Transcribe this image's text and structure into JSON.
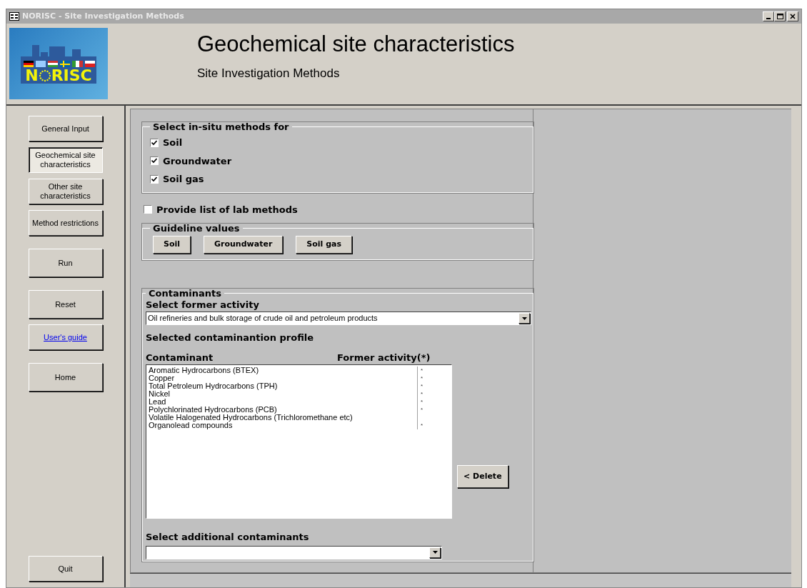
{
  "window": {
    "title": "NORISC - Site Investigation Methods"
  },
  "header": {
    "logo_letters": [
      "N",
      "RISC"
    ],
    "title": "Geochemical site characteristics",
    "subtitle": "Site Investigation Methods"
  },
  "sidebar": {
    "items": [
      {
        "label": "General Input",
        "kind": "nav",
        "selected": false
      },
      {
        "label": "Geochemical site characteristics",
        "kind": "nav",
        "selected": true
      },
      {
        "label": "Other site characteristics",
        "kind": "nav",
        "selected": false
      },
      {
        "label": "Method restrictions",
        "kind": "nav",
        "selected": false
      },
      {
        "label": "Run",
        "kind": "action",
        "selected": false
      },
      {
        "label": "Reset",
        "kind": "action",
        "selected": false
      },
      {
        "label": "User's guide",
        "kind": "link",
        "selected": false
      },
      {
        "label": "Home",
        "kind": "action",
        "selected": false
      }
    ],
    "quit": "Quit"
  },
  "in_situ": {
    "legend": "Select in-situ methods for",
    "options": [
      {
        "label": "Soil",
        "checked": true
      },
      {
        "label": "Groundwater",
        "checked": true
      },
      {
        "label": "Soil gas",
        "checked": true
      }
    ]
  },
  "lab_methods": {
    "label": "Provide list of lab methods",
    "checked": false
  },
  "guideline": {
    "legend": "Guideline values",
    "buttons": [
      "Soil",
      "Groundwater",
      "Soil gas"
    ]
  },
  "contaminants": {
    "legend": "Contaminants",
    "activity_label": "Select former activity",
    "activity_value": "Oil refineries and bulk storage of crude oil and petroleum products",
    "profile_label": "Selected contaminantion profile",
    "columns": [
      "Contaminant",
      "Former activity(*)"
    ],
    "rows": [
      {
        "name": "Aromatic Hydrocarbons (BTEX)",
        "former_activity": "*"
      },
      {
        "name": "Copper",
        "former_activity": "*"
      },
      {
        "name": "Total Petroleum Hydrocarbons (TPH)",
        "former_activity": "*"
      },
      {
        "name": "Nickel",
        "former_activity": "*"
      },
      {
        "name": "Lead",
        "former_activity": "*"
      },
      {
        "name": "Polychlorinated Hydrocarbons (PCB)",
        "former_activity": "*"
      },
      {
        "name": "Volatile Halogenated Hydrocarbons (Trichloromethane etc)"
      },
      {
        "name": "Organolead compounds",
        "former_activity": "*"
      }
    ],
    "delete_button": "< Delete",
    "additional_label": "Select additional contaminants"
  }
}
